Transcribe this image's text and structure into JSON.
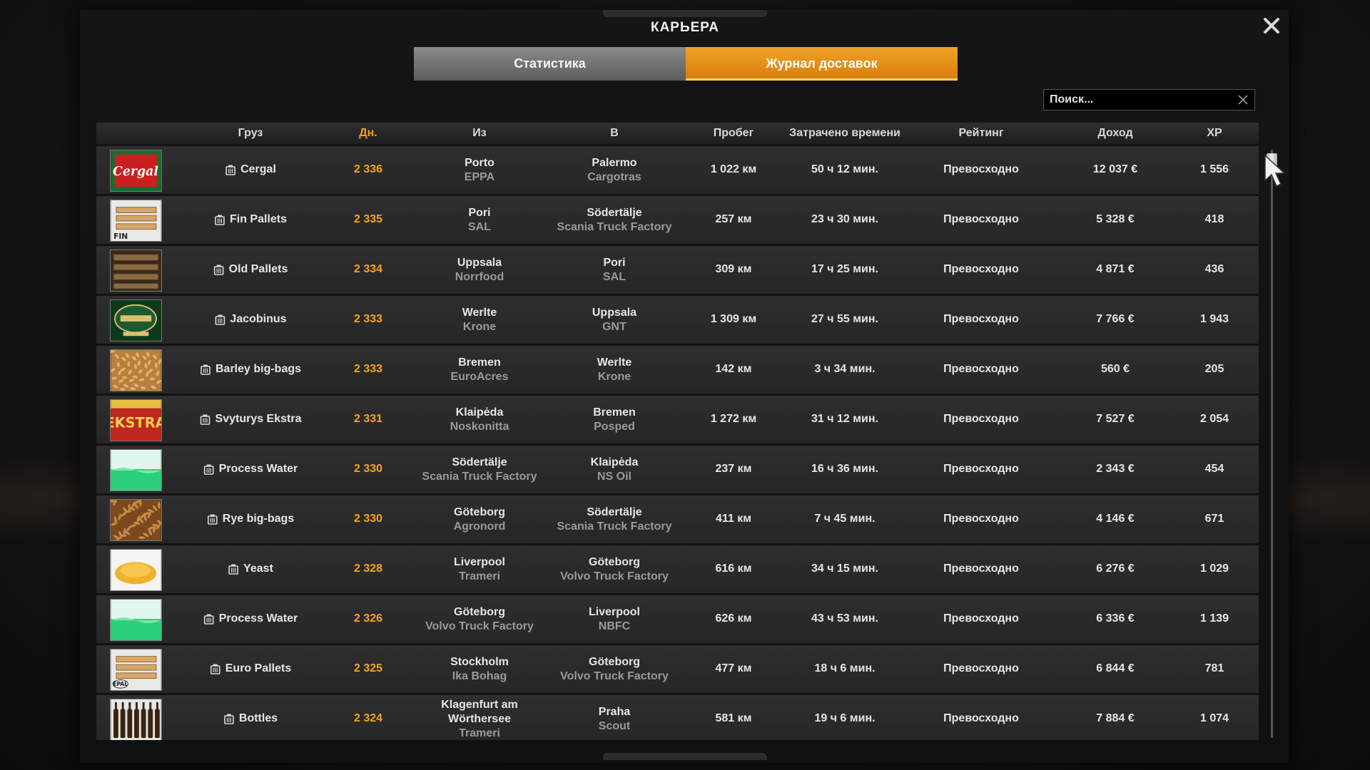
{
  "window": {
    "title": "КАРЬЕРА"
  },
  "tabs": [
    {
      "label": "Статистика",
      "active": false
    },
    {
      "label": "Журнал доставок",
      "active": true
    }
  ],
  "search": {
    "placeholder": "Поиск..."
  },
  "colors": {
    "accent": "#f4a326",
    "row_bg": "#2a2a2a",
    "sub_text": "#9a9a9a"
  },
  "columns": {
    "cargo": "Груз",
    "days": "Дн.",
    "from": "Из",
    "to": "В",
    "distance": "Пробег",
    "time": "Затрачено времени",
    "rating": "Рейтинг",
    "income": "Доход",
    "xp": "XP"
  },
  "deliveries": [
    {
      "thumb": "cergal-beer-can",
      "cargo": "Cergal",
      "days": "2 336",
      "from_city": "Porto",
      "from_company": "EPPA",
      "to_city": "Palermo",
      "to_company": "Cargotras",
      "distance": "1 022 км",
      "time": "50 ч 12 мин.",
      "rating": "Превосходно",
      "income": "12 037 €",
      "xp": "1 556"
    },
    {
      "thumb": "fin-pallets",
      "cargo": "Fin Pallets",
      "days": "2 335",
      "from_city": "Pori",
      "from_company": "SAL",
      "to_city": "Södertälje",
      "to_company": "Scania Truck Factory",
      "distance": "257 км",
      "time": "23 ч 30 мин.",
      "rating": "Превосходно",
      "income": "5 328 €",
      "xp": "418"
    },
    {
      "thumb": "old-pallets",
      "cargo": "Old Pallets",
      "days": "2 334",
      "from_city": "Uppsala",
      "from_company": "Norrfood",
      "to_city": "Pori",
      "to_company": "SAL",
      "distance": "309 км",
      "time": "17 ч 25 мин.",
      "rating": "Превосходно",
      "income": "4 871 €",
      "xp": "436"
    },
    {
      "thumb": "jacobinus-beer",
      "cargo": "Jacobinus",
      "days": "2 333",
      "from_city": "Werlte",
      "from_company": "Krone",
      "to_city": "Uppsala",
      "to_company": "GNT",
      "distance": "1 309 км",
      "time": "27 ч 55 мин.",
      "rating": "Превосходно",
      "income": "7 766 €",
      "xp": "1 943"
    },
    {
      "thumb": "barley-grain",
      "cargo": "Barley big-bags",
      "days": "2 333",
      "from_city": "Bremen",
      "from_company": "EuroAcres",
      "to_city": "Werlte",
      "to_company": "Krone",
      "distance": "142 км",
      "time": "3 ч 34 мин.",
      "rating": "Превосходно",
      "income": "560 €",
      "xp": "205"
    },
    {
      "thumb": "svyturys-ekstra-beer",
      "cargo": "Svyturys Ekstra",
      "days": "2 331",
      "from_city": "Klaipėda",
      "from_company": "Noskonitta",
      "to_city": "Bremen",
      "to_company": "Posped",
      "distance": "1 272 км",
      "time": "31 ч 12 мин.",
      "rating": "Превосходно",
      "income": "7 527 €",
      "xp": "2 054"
    },
    {
      "thumb": "process-water",
      "cargo": "Process Water",
      "days": "2 330",
      "from_city": "Södertälje",
      "from_company": "Scania Truck Factory",
      "to_city": "Klaipėda",
      "to_company": "NS Oil",
      "distance": "237 км",
      "time": "16 ч 36 мин.",
      "rating": "Превосходно",
      "income": "2 343 €",
      "xp": "454"
    },
    {
      "thumb": "rye-grain",
      "cargo": "Rye big-bags",
      "days": "2 330",
      "from_city": "Göteborg",
      "from_company": "Agronord",
      "to_city": "Södertälje",
      "to_company": "Scania Truck Factory",
      "distance": "411 км",
      "time": "7 ч 45 мин.",
      "rating": "Превосходно",
      "income": "4 146 €",
      "xp": "671"
    },
    {
      "thumb": "yeast-powder",
      "cargo": "Yeast",
      "days": "2 328",
      "from_city": "Liverpool",
      "from_company": "Trameri",
      "to_city": "Göteborg",
      "to_company": "Volvo Truck Factory",
      "distance": "616 км",
      "time": "34 ч 15 мин.",
      "rating": "Превосходно",
      "income": "6 276 €",
      "xp": "1 029"
    },
    {
      "thumb": "process-water",
      "cargo": "Process Water",
      "days": "2 326",
      "from_city": "Göteborg",
      "from_company": "Volvo Truck Factory",
      "to_city": "Liverpool",
      "to_company": "NBFC",
      "distance": "626 км",
      "time": "43 ч 53 мин.",
      "rating": "Превосходно",
      "income": "6 336 €",
      "xp": "1 139"
    },
    {
      "thumb": "euro-pallets",
      "cargo": "Euro Pallets",
      "days": "2 325",
      "from_city": "Stockholm",
      "from_company": "Ika Bohag",
      "to_city": "Göteborg",
      "to_company": "Volvo Truck Factory",
      "distance": "477 км",
      "time": "18 ч 6 мин.",
      "rating": "Превосходно",
      "income": "6 844 €",
      "xp": "781"
    },
    {
      "thumb": "bottles",
      "cargo": "Bottles",
      "days": "2 324",
      "from_city": "Klagenfurt am Wörthersee",
      "from_city_line1": "Klagenfurt am",
      "from_city_line2": "Wörthersee",
      "from_company": "Trameri",
      "to_city": "Praha",
      "to_company": "Scout",
      "distance": "581 км",
      "time": "19 ч 6 мин.",
      "rating": "Превосходно",
      "income": "7 884 €",
      "xp": "1 074"
    }
  ]
}
